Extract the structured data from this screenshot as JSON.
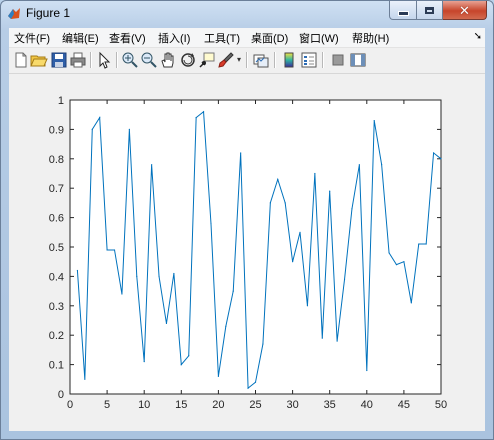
{
  "window": {
    "title": "Figure 1"
  },
  "menu": [
    "文件(F)",
    "编辑(E)",
    "查看(V)",
    "插入(I)",
    "工具(T)",
    "桌面(D)",
    "窗口(W)",
    "帮助(H)"
  ],
  "toolbar_icons": [
    "new-figure-icon",
    "open-file-icon",
    "save-icon",
    "print-icon",
    "select-arrow-icon",
    "zoom-in-icon",
    "zoom-out-icon",
    "pan-hand-icon",
    "rotate-3d-icon",
    "data-cursor-icon",
    "brush-icon",
    "brush-dropdown-icon",
    "link-plot-icon",
    "insert-colorbar-icon",
    "insert-legend-icon",
    "hide-plot-tools-icon",
    "show-plot-tools-icon"
  ],
  "colors": {
    "line": "#0072bd",
    "axes_bg": "#ffffff",
    "figure_bg": "#f0f0f0"
  },
  "chart_data": {
    "type": "line",
    "title": "",
    "xlabel": "",
    "ylabel": "",
    "xlim": [
      0,
      50
    ],
    "ylim": [
      0,
      1
    ],
    "xticks": [
      0,
      5,
      10,
      15,
      20,
      25,
      30,
      35,
      40,
      45,
      50
    ],
    "yticks": [
      0,
      0.1,
      0.2,
      0.3,
      0.4,
      0.5,
      0.6,
      0.7,
      0.8,
      0.9,
      1
    ],
    "ytick_labels": [
      "0",
      "0.1",
      "0.2",
      "0.3",
      "0.4",
      "0.5",
      "0.6",
      "0.7",
      "0.8",
      "0.9",
      "1"
    ],
    "grid": false,
    "series": [
      {
        "x": [
          1,
          2,
          3,
          4,
          5,
          6,
          7,
          8,
          9,
          10,
          11,
          12,
          13,
          14,
          15,
          16,
          17,
          18,
          19,
          20,
          21,
          22,
          23,
          24,
          25,
          26,
          27,
          28,
          29,
          30,
          31,
          32,
          33,
          34,
          35,
          36,
          37,
          38,
          39,
          40,
          41,
          42,
          43,
          44,
          45,
          46,
          47,
          48,
          49,
          50
        ],
        "values": [
          0.42,
          0.05,
          0.9,
          0.94,
          0.49,
          0.49,
          0.34,
          0.9,
          0.4,
          0.11,
          0.78,
          0.4,
          0.24,
          0.41,
          0.1,
          0.13,
          0.94,
          0.96,
          0.58,
          0.06,
          0.23,
          0.35,
          0.82,
          0.02,
          0.04,
          0.17,
          0.65,
          0.73,
          0.65,
          0.45,
          0.55,
          0.3,
          0.75,
          0.19,
          0.69,
          0.18,
          0.39,
          0.63,
          0.78,
          0.08,
          0.93,
          0.78,
          0.48,
          0.44,
          0.45,
          0.31,
          0.51,
          0.51,
          0.82,
          0.8
        ]
      }
    ]
  }
}
